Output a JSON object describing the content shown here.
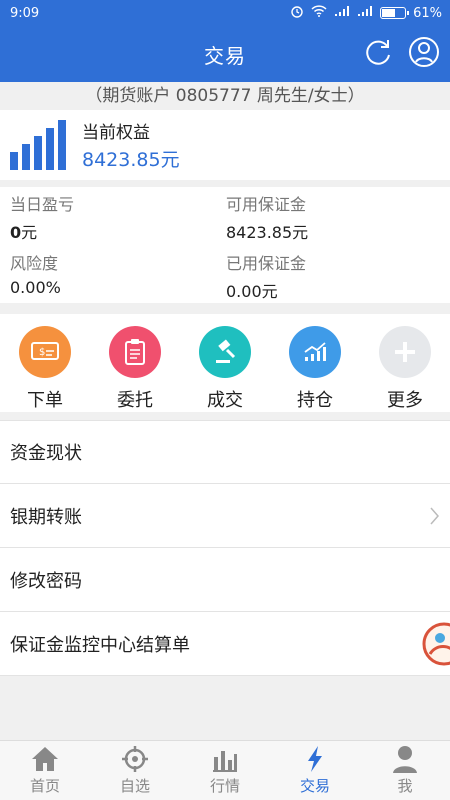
{
  "status_bar": {
    "time": "9:09",
    "battery_percent": "61%",
    "battery_level": 0.61
  },
  "header": {
    "title": "交易",
    "refresh_icon": "refresh-icon",
    "profile_icon": "user-icon"
  },
  "account": {
    "line": "（期货账户 0805777 周先生/女士）"
  },
  "equity": {
    "label": "当前权益",
    "value": "8423.85元",
    "icon": "bar-chart-icon"
  },
  "stats": {
    "daily_pnl": {
      "label": "当日盈亏",
      "value_bold": "0",
      "unit": "元"
    },
    "available_margin": {
      "label": "可用保证金",
      "value": "8423.85元"
    },
    "risk_level": {
      "label": "风险度",
      "value": "0.00%"
    },
    "used_margin": {
      "label": "已用保证金",
      "value": "0.00元"
    }
  },
  "actions": [
    {
      "label": "下单",
      "icon": "order-icon",
      "color": "#f5913e"
    },
    {
      "label": "委托",
      "icon": "clipboard-icon",
      "color": "#f0506e"
    },
    {
      "label": "成交",
      "icon": "gavel-icon",
      "color": "#1fbfbf"
    },
    {
      "label": "持仓",
      "icon": "trend-chart-icon",
      "color": "#3f9be8"
    },
    {
      "label": "更多",
      "icon": "plus-icon",
      "color": "#e6e8eb"
    }
  ],
  "menu": [
    {
      "label": "资金现状"
    },
    {
      "label": "银期转账"
    },
    {
      "label": "修改密码"
    },
    {
      "label": "保证金监控中心结算单"
    }
  ],
  "bottom_nav": [
    {
      "label": "首页",
      "icon": "home-icon"
    },
    {
      "label": "自选",
      "icon": "target-icon"
    },
    {
      "label": "行情",
      "icon": "chart-icon"
    },
    {
      "label": "交易",
      "icon": "lightning-icon",
      "active": true
    },
    {
      "label": "我",
      "icon": "person-icon"
    }
  ],
  "colors": {
    "brand_blue": "#2f6fd6",
    "accent_text": "#2f6fd6"
  }
}
